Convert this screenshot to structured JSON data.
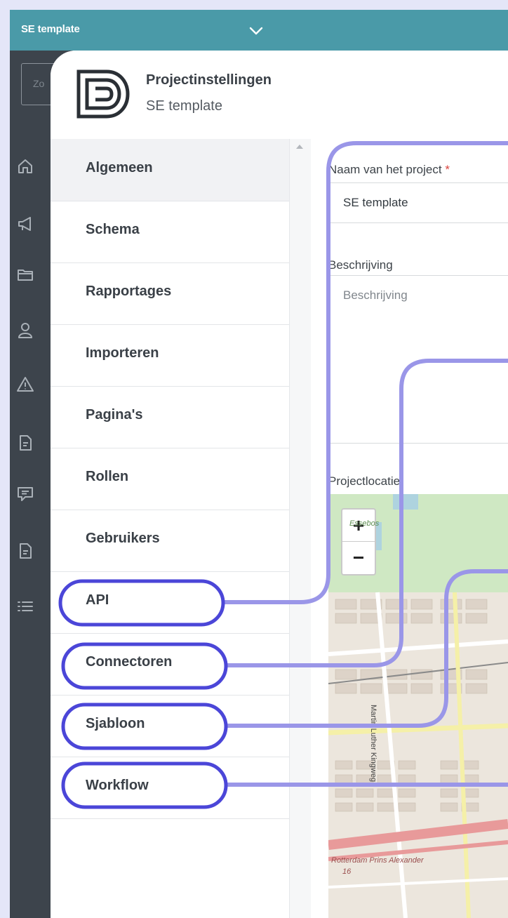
{
  "app": {
    "project_name": "SE template"
  },
  "search": {
    "placeholder": "Zo"
  },
  "nav_icons": [
    "home-icon",
    "megaphone-icon",
    "folder-icon",
    "user-icon",
    "warning-icon",
    "document-icon",
    "chat-icon",
    "file-icon",
    "list-icon"
  ],
  "modal": {
    "title": "Projectinstellingen",
    "subtitle": "SE template"
  },
  "sidebar": {
    "items": [
      {
        "label": "Algemeen"
      },
      {
        "label": "Schema"
      },
      {
        "label": "Rapportages"
      },
      {
        "label": "Importeren"
      },
      {
        "label": "Pagina's"
      },
      {
        "label": "Rollen"
      },
      {
        "label": "Gebruikers"
      },
      {
        "label": "API"
      },
      {
        "label": "Connectoren"
      },
      {
        "label": "Sjabloon"
      },
      {
        "label": "Workflow"
      }
    ],
    "active_index": 0
  },
  "form": {
    "name_label": "Naam van het project",
    "required_mark": "*",
    "name_value": "SE template",
    "description_label": "Beschrijving",
    "description_placeholder": "Beschrijving",
    "location_label": "Projectlocatie"
  },
  "map": {
    "zoom_in": "+",
    "zoom_out": "−",
    "labels": {
      "park": "Essebos",
      "street1": "Martin Luther Kingweg",
      "street2": "Rotterdam Prins Alexander",
      "street2_num": "16"
    }
  },
  "colors": {
    "topbar": "#4a9aa8",
    "sidebar_dark": "#3d444c",
    "highlight": "#4b46d8",
    "connector": "#9a96e8"
  }
}
